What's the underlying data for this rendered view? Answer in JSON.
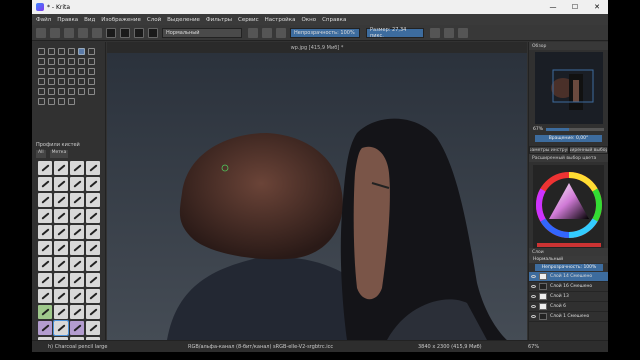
{
  "window": {
    "title": "* - Krita",
    "controls": [
      "—",
      "☐",
      "✕"
    ]
  },
  "menu": [
    "Файл",
    "Правка",
    "Вид",
    "Изображение",
    "Слой",
    "Выделение",
    "Фильтры",
    "Сервис",
    "Настройка",
    "Окно",
    "Справка"
  ],
  "toolbar": {
    "blend_mode": "Нормальный",
    "opacity": "Непрозрачность: 100%",
    "size": "Размер: 27,34 пикс."
  },
  "document_tab": "wp.jpg [415,9 Миб] *",
  "brush_presets": {
    "title": "Профили кистей",
    "filter_all": "All",
    "filter_tag": "Метка"
  },
  "overview": {
    "title": "Обзор",
    "zoom": "67%",
    "rotation": "Вращение: 0,00°"
  },
  "right_tabs": [
    "Параметры инструм...",
    "Расширенный выбор ц..."
  ],
  "color_panel_title": "Расширенный выбор цвета",
  "layers": {
    "title": "Слои",
    "blend": "Нормальный",
    "opacity": "Непрозрачность: 100%",
    "items": [
      {
        "name": "Слой 14 Смешено",
        "selected": true
      },
      {
        "name": "Слой 16 Смешено",
        "selected": false
      },
      {
        "name": "Слой 13",
        "selected": false
      },
      {
        "name": "Слой 6",
        "selected": false
      },
      {
        "name": "Слой 1 Смешено",
        "selected": false
      }
    ]
  },
  "status": {
    "brush_name": "h) Charcoal pencil large",
    "color_info": "RGB/альфа-канал (8-бит/канал) sRGB-elle-V2-srgbtrc.icc",
    "dimensions": "3840 x 2300 (415,9 Миб)",
    "zoom": "67%"
  },
  "colors": {
    "accent": "#3d6c9e",
    "ui_bg": "#323232"
  }
}
